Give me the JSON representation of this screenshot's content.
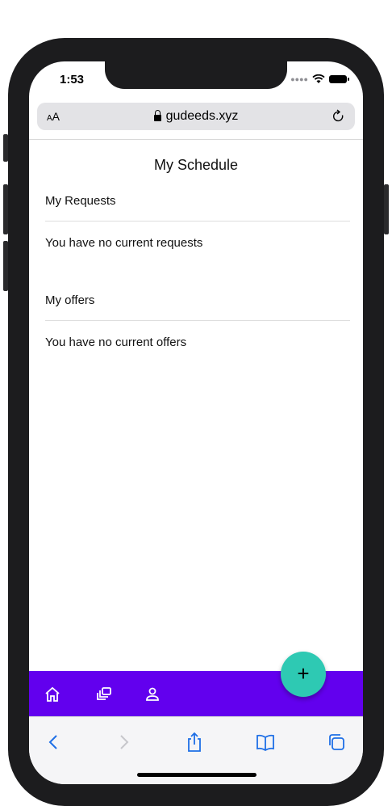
{
  "status_bar": {
    "time": "1:53"
  },
  "browser": {
    "text_size_label_small": "A",
    "text_size_label_large": "A",
    "domain": "gudeeds.xyz"
  },
  "page": {
    "title": "My Schedule",
    "requests_heading": "My Requests",
    "requests_empty": "You have no current requests",
    "offers_heading": "My offers",
    "offers_empty": "You have no current offers"
  },
  "fab": {
    "label": "+"
  },
  "colors": {
    "nav_bg": "#6200ee",
    "fab_bg": "#2ec9b3",
    "toolbar_blue": "#1e6fe6"
  },
  "icons": {
    "nav": [
      "home-icon",
      "collections-icon",
      "profile-icon"
    ],
    "toolbar": [
      "back-icon",
      "forward-icon",
      "share-icon",
      "bookmarks-icon",
      "tabs-icon"
    ]
  }
}
